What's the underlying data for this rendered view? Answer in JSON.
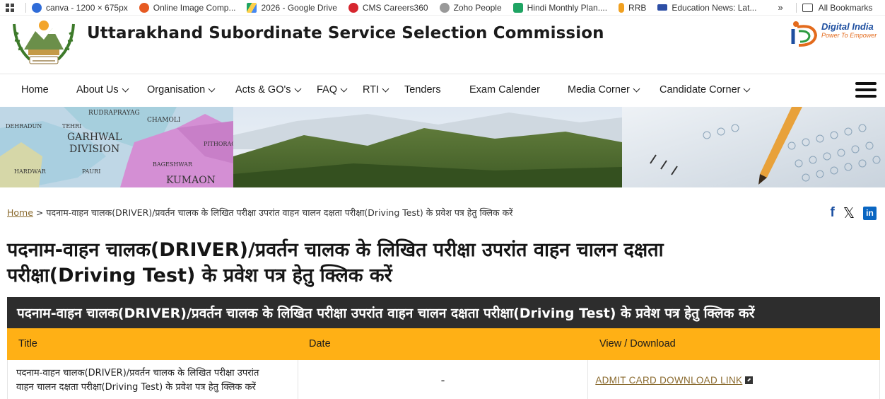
{
  "bookmarks": {
    "items": [
      {
        "label": "canva - 1200 × 675px",
        "color": "#2f6cd8"
      },
      {
        "label": "Online Image Comp...",
        "color": "#e65a22"
      },
      {
        "label": "2026 - Google Drive",
        "color": "#1fa463"
      },
      {
        "label": "CMS Careers360",
        "color": "#d6262e"
      },
      {
        "label": "Zoho People",
        "color": "#888888"
      },
      {
        "label": "Hindi Monthly Plan....",
        "color": "#1fa463"
      },
      {
        "label": "RRB",
        "color": "#f0a020"
      },
      {
        "label": "Education News: Lat...",
        "color": "#2d4ea5"
      }
    ],
    "more": "»",
    "all_label": "All Bookmarks"
  },
  "header": {
    "title": "Uttarakhand Subordinate Service Selection Commission",
    "digital_india": "Digital India",
    "digital_india_tagline": "Power To Empower"
  },
  "nav": {
    "items": [
      "Home",
      "About Us",
      "Organisation",
      "Acts & GO's",
      "FAQ",
      "RTI",
      "Tenders",
      "Exam Calender",
      "Media Corner",
      "Candidate Corner"
    ]
  },
  "banner": {
    "map_labels": [
      "RUDRAPRAYAG",
      "CHAMOLI",
      "DEHRADUN",
      "TEHRI",
      "GARHWAL",
      "DIVISION",
      "PITHORAGARH",
      "BAGESHWAR",
      "HARDWAR",
      "PAURI",
      "KUMAON"
    ]
  },
  "breadcrumb": {
    "home": "Home",
    "separator": ">",
    "current": "पदनाम-वाहन चालक(DRIVER)/प्रवर्तन चालक के लिखित परीक्षा उपरांत वाहन चालन दक्षता परीक्षा(Driving Test) के प्रवेश पत्र हेतु क्लिक करें"
  },
  "social": {
    "facebook": "f",
    "x": "𝕏",
    "linkedin": "in"
  },
  "page": {
    "title_line1": "पदनाम-वाहन चालक(DRIVER)/प्रवर्तन चालक के लिखित परीक्षा उपरांत वाहन चालन दक्षता",
    "title_line2": "परीक्षा(Driving Test) के प्रवेश पत्र हेतु क्लिक करें"
  },
  "table": {
    "caption": "पदनाम-वाहन चालक(DRIVER)/प्रवर्तन चालक के लिखित परीक्षा उपरांत वाहन चालन दक्षता परीक्षा(Driving Test) के प्रवेश पत्र हेतु क्लिक करें",
    "headers": [
      "Title",
      "Date",
      "View / Download"
    ],
    "rows": [
      {
        "title_line1": "पदनाम-वाहन चालक(DRIVER)/प्रवर्तन चालक के लिखित परीक्षा उपरांत",
        "title_line2": "वाहन चालन दक्षता परीक्षा(Driving Test) के प्रवेश पत्र हेतु क्लिक करें",
        "date": "-",
        "link": "ADMIT CARD DOWNLOAD LINK"
      }
    ]
  },
  "colors": {
    "table_header": "#ffb015",
    "caption_bg": "#2d2d2d",
    "link": "#8a6a2e"
  }
}
